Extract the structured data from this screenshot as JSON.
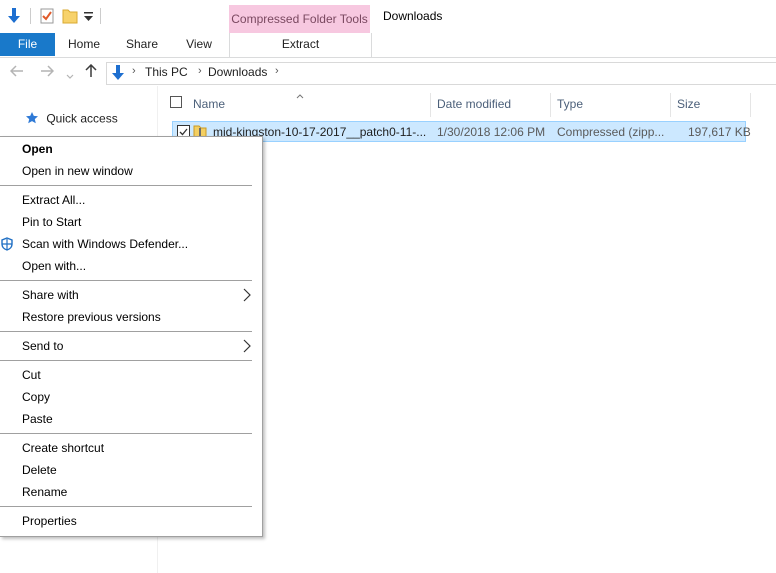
{
  "window": {
    "title": "Downloads"
  },
  "ribbon": {
    "contextual_tab": "Compressed Folder Tools",
    "tabs": [
      "File",
      "Home",
      "Share",
      "View",
      "Extract"
    ]
  },
  "address": {
    "crumbs": [
      "This PC",
      "Downloads"
    ]
  },
  "navpane": {
    "quick_access": "Quick access"
  },
  "columns": {
    "name": "Name",
    "date": "Date modified",
    "type": "Type",
    "size": "Size"
  },
  "file": {
    "name": "mid-kingston-10-17-2017__patch0-11-...",
    "date": "1/30/2018 12:06 PM",
    "type": "Compressed (zipp...",
    "size": "197,617 KB"
  },
  "menu": {
    "open": "Open",
    "open_new_window": "Open in new window",
    "extract_all": "Extract All...",
    "pin_start": "Pin to Start",
    "scan_defender": "Scan with Windows Defender...",
    "open_with": "Open with...",
    "share_with": "Share with",
    "restore": "Restore previous versions",
    "send_to": "Send to",
    "cut": "Cut",
    "copy": "Copy",
    "paste": "Paste",
    "create_shortcut": "Create shortcut",
    "delete": "Delete",
    "rename": "Rename",
    "properties": "Properties"
  },
  "icons": {
    "qat_down_arrow": "down-arrow-icon",
    "qat_properties": "properties-icon",
    "qat_new_folder": "new-folder-icon",
    "qat_customize": "customize-dropdown-icon",
    "downloads": "downloads-icon",
    "quick_access": "star-icon",
    "zip": "zip-folder-icon",
    "defender": "windows-defender-icon",
    "submenu": "chevron-right-icon"
  },
  "colors": {
    "accent": "#1979ca",
    "selection": "#cce8ff",
    "contextual_tab": "#f7c8e0"
  }
}
